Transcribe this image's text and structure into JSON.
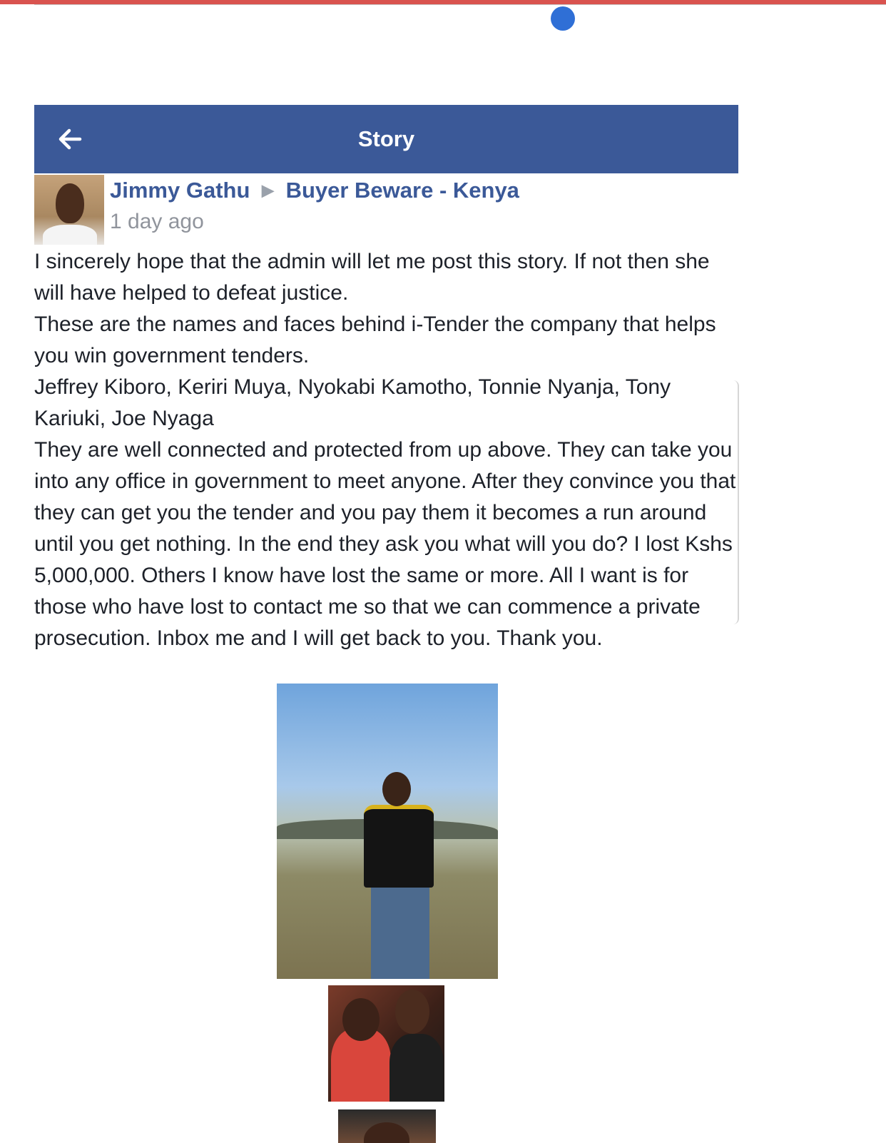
{
  "app_bar": {
    "title": "Story",
    "back_icon": "arrow-left-icon",
    "color": "#3b5998"
  },
  "post": {
    "author": "Jimmy Gathu",
    "separator_icon": "triangle-right-icon",
    "group": "Buyer Beware - Kenya",
    "time": "1 day ago",
    "paragraphs": [
      "I sincerely hope that the admin will let me post this story. If not then she will have helped to defeat justice.",
      "These are the names and faces behind i-Tender the company that helps you win government tenders.",
      "Jeffrey Kiboro, Keriri Muya, Nyokabi Kamotho, Tonnie Nyanja, Tony Kariuki, Joe Nyaga",
      "They are well connected and protected from up above. They can take you into any office in government to meet anyone. After they convince you that they can get you the tender and you pay them it becomes a run around until you get nothing. In the end they ask you what will you do? I lost Kshs 5,000,000. Others I know have lost the same or more. All I want is for those who have lost to contact me so that we can commence a private prosecution. Inbox me and I will get back to you. Thank you."
    ]
  },
  "colors": {
    "top_strip": "#d9534f",
    "scroll_indicator": "#2f6fd6",
    "link": "#3b5998",
    "muted": "#90949c"
  }
}
